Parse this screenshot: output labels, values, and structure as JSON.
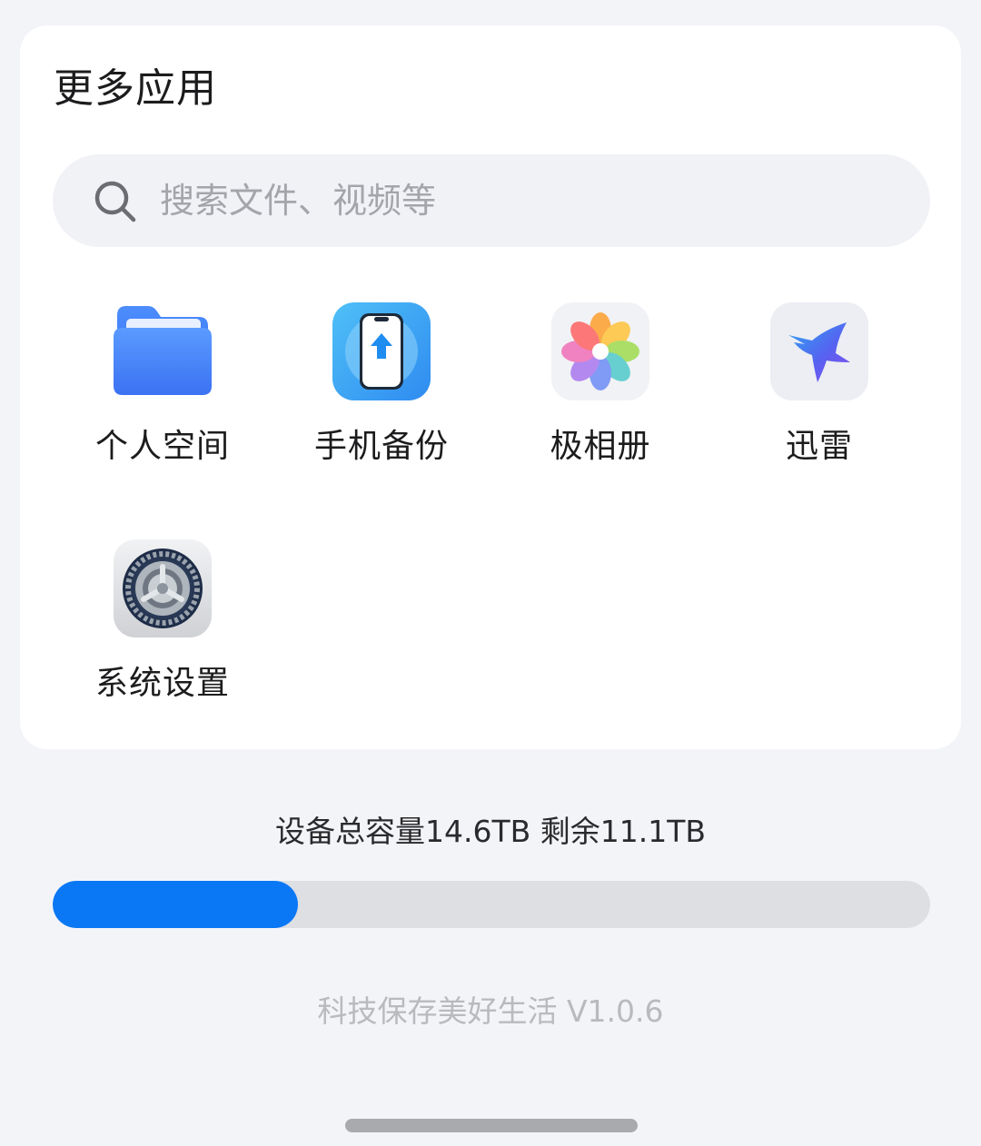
{
  "card": {
    "title": "更多应用"
  },
  "search": {
    "placeholder": "搜索文件、视频等",
    "icon": "search-icon"
  },
  "apps": [
    {
      "label": "个人空间",
      "icon": "folder-icon"
    },
    {
      "label": "手机备份",
      "icon": "phone-backup-icon"
    },
    {
      "label": "极相册",
      "icon": "photo-flower-icon"
    },
    {
      "label": "迅雷",
      "icon": "hummingbird-icon"
    },
    {
      "label": "系统设置",
      "icon": "gear-icon"
    }
  ],
  "storage": {
    "summary": "设备总容量14.6TB 剩余11.1TB",
    "used_fraction": 0.28,
    "fill_color": "#0a78f5"
  },
  "footer": {
    "slogan": "科技保存美好生活 V1.0.6"
  }
}
